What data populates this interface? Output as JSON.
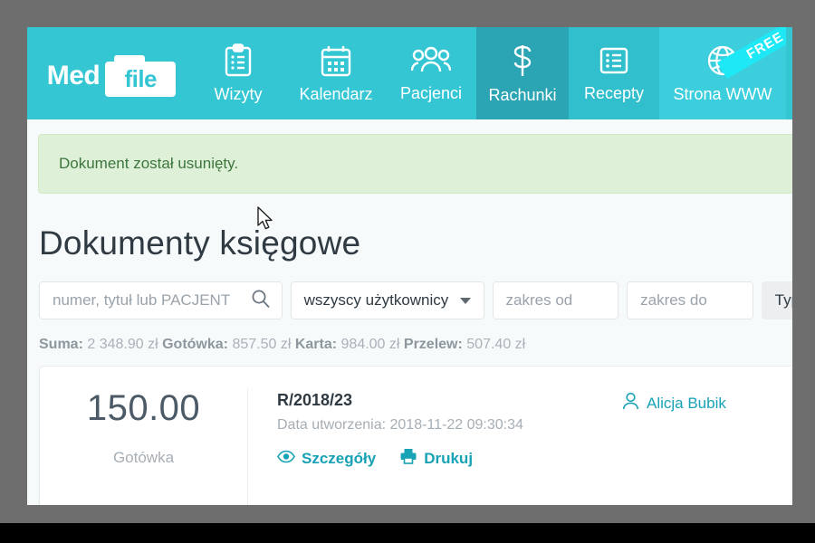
{
  "brand": {
    "word_med": "Med",
    "word_file": "file"
  },
  "nav": {
    "items": [
      {
        "label": "Wizyty",
        "icon": "clipboard-icon",
        "active": false
      },
      {
        "label": "Kalendarz",
        "icon": "calendar-icon",
        "active": false
      },
      {
        "label": "Pacjenci",
        "icon": "people-icon",
        "active": false
      },
      {
        "label": "Rachunki",
        "icon": "dollar-icon",
        "active": true
      },
      {
        "label": "Recepty",
        "icon": "list-icon",
        "active": false
      },
      {
        "label": "Strona WWW",
        "icon": "globe-icon",
        "active": false,
        "ribbon": "FREE"
      }
    ]
  },
  "alert": {
    "message": "Dokument został usunięty."
  },
  "page": {
    "title": "Dokumenty księgowe"
  },
  "filters": {
    "search_placeholder": "numer, tytuł lub PACJENT",
    "search_value": "",
    "search_icon": "search-icon",
    "user_select_value": "wszyscy użytkownicy",
    "date_from_placeholder": "zakres od",
    "date_from_value": "",
    "date_to_placeholder": "zakres do",
    "date_to_value": "",
    "type_button_label": "Typ"
  },
  "summary": {
    "suma_label": "Suma:",
    "suma_value": "2 348.90 zł",
    "gotowka_label": "Gotówka:",
    "gotowka_value": "857.50 zł",
    "karta_label": "Karta:",
    "karta_value": "984.00 zł",
    "przelew_label": "Przelew:",
    "przelew_value": "507.40 zł"
  },
  "documents": [
    {
      "amount": "150.00",
      "payment_method": "Gotówka",
      "number": "R/2018/23",
      "created_label": "Data utworzenia: 2018-11-22 09:30:34",
      "details_label": "Szczegóły",
      "print_label": "Drukuj",
      "user": "Alicja Bubik"
    }
  ],
  "colors": {
    "brand_teal": "#35c6d4",
    "active_tab_teal": "#2ba5b3",
    "ribbon_cyan": "#1fe8f6",
    "link_teal": "#18a2b5",
    "alert_green_bg": "#dff0d8",
    "alert_green_text": "#3c763d"
  }
}
